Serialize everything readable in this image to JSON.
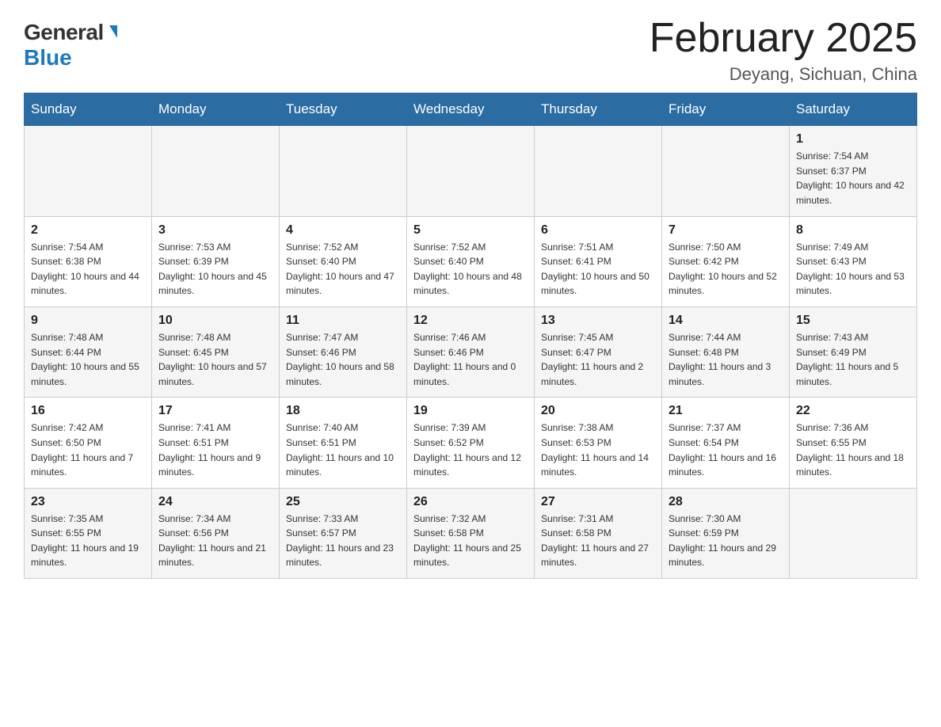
{
  "logo": {
    "general": "General",
    "blue": "Blue",
    "arrow": "▼"
  },
  "title": "February 2025",
  "subtitle": "Deyang, Sichuan, China",
  "days_of_week": [
    "Sunday",
    "Monday",
    "Tuesday",
    "Wednesday",
    "Thursday",
    "Friday",
    "Saturday"
  ],
  "weeks": [
    [
      {
        "day": "",
        "sunrise": "",
        "sunset": "",
        "daylight": ""
      },
      {
        "day": "",
        "sunrise": "",
        "sunset": "",
        "daylight": ""
      },
      {
        "day": "",
        "sunrise": "",
        "sunset": "",
        "daylight": ""
      },
      {
        "day": "",
        "sunrise": "",
        "sunset": "",
        "daylight": ""
      },
      {
        "day": "",
        "sunrise": "",
        "sunset": "",
        "daylight": ""
      },
      {
        "day": "",
        "sunrise": "",
        "sunset": "",
        "daylight": ""
      },
      {
        "day": "1",
        "sunrise": "Sunrise: 7:54 AM",
        "sunset": "Sunset: 6:37 PM",
        "daylight": "Daylight: 10 hours and 42 minutes."
      }
    ],
    [
      {
        "day": "2",
        "sunrise": "Sunrise: 7:54 AM",
        "sunset": "Sunset: 6:38 PM",
        "daylight": "Daylight: 10 hours and 44 minutes."
      },
      {
        "day": "3",
        "sunrise": "Sunrise: 7:53 AM",
        "sunset": "Sunset: 6:39 PM",
        "daylight": "Daylight: 10 hours and 45 minutes."
      },
      {
        "day": "4",
        "sunrise": "Sunrise: 7:52 AM",
        "sunset": "Sunset: 6:40 PM",
        "daylight": "Daylight: 10 hours and 47 minutes."
      },
      {
        "day": "5",
        "sunrise": "Sunrise: 7:52 AM",
        "sunset": "Sunset: 6:40 PM",
        "daylight": "Daylight: 10 hours and 48 minutes."
      },
      {
        "day": "6",
        "sunrise": "Sunrise: 7:51 AM",
        "sunset": "Sunset: 6:41 PM",
        "daylight": "Daylight: 10 hours and 50 minutes."
      },
      {
        "day": "7",
        "sunrise": "Sunrise: 7:50 AM",
        "sunset": "Sunset: 6:42 PM",
        "daylight": "Daylight: 10 hours and 52 minutes."
      },
      {
        "day": "8",
        "sunrise": "Sunrise: 7:49 AM",
        "sunset": "Sunset: 6:43 PM",
        "daylight": "Daylight: 10 hours and 53 minutes."
      }
    ],
    [
      {
        "day": "9",
        "sunrise": "Sunrise: 7:48 AM",
        "sunset": "Sunset: 6:44 PM",
        "daylight": "Daylight: 10 hours and 55 minutes."
      },
      {
        "day": "10",
        "sunrise": "Sunrise: 7:48 AM",
        "sunset": "Sunset: 6:45 PM",
        "daylight": "Daylight: 10 hours and 57 minutes."
      },
      {
        "day": "11",
        "sunrise": "Sunrise: 7:47 AM",
        "sunset": "Sunset: 6:46 PM",
        "daylight": "Daylight: 10 hours and 58 minutes."
      },
      {
        "day": "12",
        "sunrise": "Sunrise: 7:46 AM",
        "sunset": "Sunset: 6:46 PM",
        "daylight": "Daylight: 11 hours and 0 minutes."
      },
      {
        "day": "13",
        "sunrise": "Sunrise: 7:45 AM",
        "sunset": "Sunset: 6:47 PM",
        "daylight": "Daylight: 11 hours and 2 minutes."
      },
      {
        "day": "14",
        "sunrise": "Sunrise: 7:44 AM",
        "sunset": "Sunset: 6:48 PM",
        "daylight": "Daylight: 11 hours and 3 minutes."
      },
      {
        "day": "15",
        "sunrise": "Sunrise: 7:43 AM",
        "sunset": "Sunset: 6:49 PM",
        "daylight": "Daylight: 11 hours and 5 minutes."
      }
    ],
    [
      {
        "day": "16",
        "sunrise": "Sunrise: 7:42 AM",
        "sunset": "Sunset: 6:50 PM",
        "daylight": "Daylight: 11 hours and 7 minutes."
      },
      {
        "day": "17",
        "sunrise": "Sunrise: 7:41 AM",
        "sunset": "Sunset: 6:51 PM",
        "daylight": "Daylight: 11 hours and 9 minutes."
      },
      {
        "day": "18",
        "sunrise": "Sunrise: 7:40 AM",
        "sunset": "Sunset: 6:51 PM",
        "daylight": "Daylight: 11 hours and 10 minutes."
      },
      {
        "day": "19",
        "sunrise": "Sunrise: 7:39 AM",
        "sunset": "Sunset: 6:52 PM",
        "daylight": "Daylight: 11 hours and 12 minutes."
      },
      {
        "day": "20",
        "sunrise": "Sunrise: 7:38 AM",
        "sunset": "Sunset: 6:53 PM",
        "daylight": "Daylight: 11 hours and 14 minutes."
      },
      {
        "day": "21",
        "sunrise": "Sunrise: 7:37 AM",
        "sunset": "Sunset: 6:54 PM",
        "daylight": "Daylight: 11 hours and 16 minutes."
      },
      {
        "day": "22",
        "sunrise": "Sunrise: 7:36 AM",
        "sunset": "Sunset: 6:55 PM",
        "daylight": "Daylight: 11 hours and 18 minutes."
      }
    ],
    [
      {
        "day": "23",
        "sunrise": "Sunrise: 7:35 AM",
        "sunset": "Sunset: 6:55 PM",
        "daylight": "Daylight: 11 hours and 19 minutes."
      },
      {
        "day": "24",
        "sunrise": "Sunrise: 7:34 AM",
        "sunset": "Sunset: 6:56 PM",
        "daylight": "Daylight: 11 hours and 21 minutes."
      },
      {
        "day": "25",
        "sunrise": "Sunrise: 7:33 AM",
        "sunset": "Sunset: 6:57 PM",
        "daylight": "Daylight: 11 hours and 23 minutes."
      },
      {
        "day": "26",
        "sunrise": "Sunrise: 7:32 AM",
        "sunset": "Sunset: 6:58 PM",
        "daylight": "Daylight: 11 hours and 25 minutes."
      },
      {
        "day": "27",
        "sunrise": "Sunrise: 7:31 AM",
        "sunset": "Sunset: 6:58 PM",
        "daylight": "Daylight: 11 hours and 27 minutes."
      },
      {
        "day": "28",
        "sunrise": "Sunrise: 7:30 AM",
        "sunset": "Sunset: 6:59 PM",
        "daylight": "Daylight: 11 hours and 29 minutes."
      },
      {
        "day": "",
        "sunrise": "",
        "sunset": "",
        "daylight": ""
      }
    ]
  ]
}
